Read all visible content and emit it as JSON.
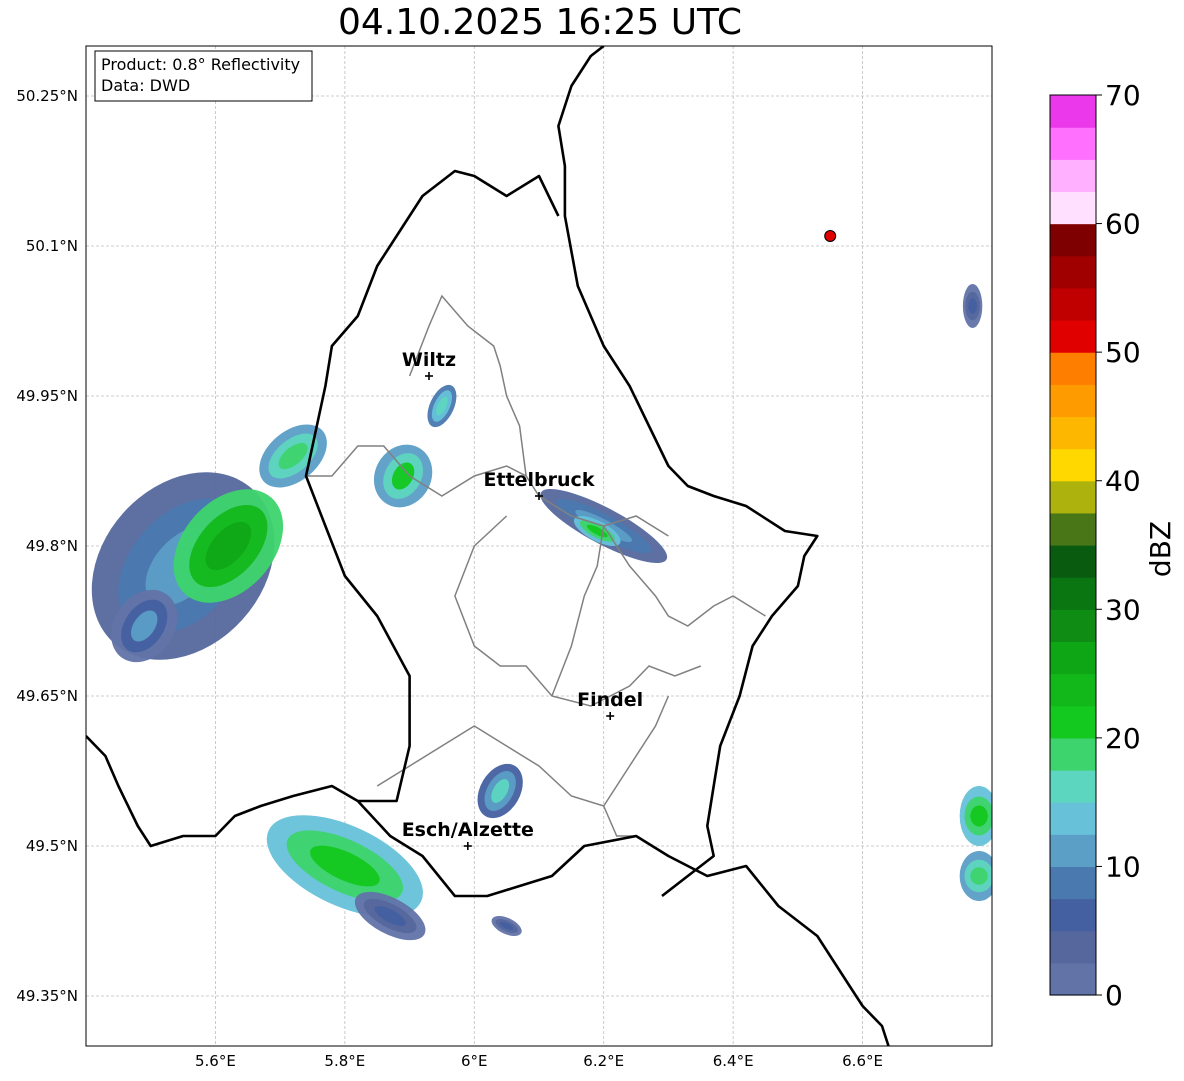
{
  "map": {
    "title": "04.10.2025 16:25 UTC",
    "info": {
      "product": "Product: 0.8° Reflectivity",
      "data": "Data: DWD"
    },
    "lat_ticks": [
      "50.25°N",
      "50.1°N",
      "49.95°N",
      "49.8°N",
      "49.65°N",
      "49.5°N",
      "49.35°N"
    ],
    "lon_ticks": [
      "5.6°E",
      "5.8°E",
      "6°E",
      "6.2°E",
      "6.4°E",
      "6.6°E"
    ],
    "extent": {
      "lon_min": 5.4,
      "lon_max": 6.8,
      "lat_min": 49.3,
      "lat_max": 50.3
    },
    "cities": [
      {
        "name": "Wiltz",
        "lon": 5.93,
        "lat": 49.97
      },
      {
        "name": "Ettelbruck",
        "lon": 6.1,
        "lat": 49.85
      },
      {
        "name": "Findel",
        "lon": 6.21,
        "lat": 49.63
      },
      {
        "name": "Esch/Alzette",
        "lon": 5.99,
        "lat": 49.5
      }
    ],
    "marker": {
      "lon": 6.55,
      "lat": 50.11,
      "color": "#e00000"
    }
  },
  "colorbar": {
    "label": "dBZ",
    "tick_labels": [
      "0",
      "10",
      "20",
      "30",
      "40",
      "50",
      "60",
      "70"
    ],
    "min": 0,
    "max": 70,
    "step": 2.5,
    "colors": [
      "#6273a8",
      "#55679d",
      "#4560a0",
      "#4a79b0",
      "#5b9ec6",
      "#66c1d9",
      "#5dd6c0",
      "#3dd46d",
      "#13c81e",
      "#12b81a",
      "#0fa616",
      "#0e8c14",
      "#0a7612",
      "#095c0f",
      "#497616",
      "#adb30c",
      "#ffd800",
      "#fdb700",
      "#fe9b00",
      "#fe7e00",
      "#e00000",
      "#c00000",
      "#a00000",
      "#7f0000",
      "#ffe0ff",
      "#ffb0ff",
      "#ff70ff",
      "#ea38ea"
    ]
  },
  "radar_echoes": [
    {
      "lon": 5.55,
      "lat": 49.78,
      "rx": 0.16,
      "ry": 0.08,
      "angle": -48,
      "dbz": 12
    },
    {
      "lon": 5.62,
      "lat": 49.8,
      "rx": 0.1,
      "ry": 0.045,
      "angle": -48,
      "dbz": 26
    },
    {
      "lon": 5.72,
      "lat": 49.89,
      "rx": 0.06,
      "ry": 0.025,
      "angle": -40,
      "dbz": 18
    },
    {
      "lon": 5.49,
      "lat": 49.72,
      "rx": 0.06,
      "ry": 0.03,
      "angle": -55,
      "dbz": 10
    },
    {
      "lon": 5.89,
      "lat": 49.87,
      "rx": 0.05,
      "ry": 0.028,
      "angle": -60,
      "dbz": 20
    },
    {
      "lon": 5.95,
      "lat": 49.94,
      "rx": 0.035,
      "ry": 0.012,
      "angle": -65,
      "dbz": 16
    },
    {
      "lon": 6.2,
      "lat": 49.82,
      "rx": 0.11,
      "ry": 0.018,
      "angle": 28,
      "dbz": 12
    },
    {
      "lon": 6.19,
      "lat": 49.815,
      "rx": 0.04,
      "ry": 0.01,
      "angle": 28,
      "dbz": 22
    },
    {
      "lon": 6.04,
      "lat": 49.555,
      "rx": 0.045,
      "ry": 0.02,
      "angle": -60,
      "dbz": 15
    },
    {
      "lon": 5.8,
      "lat": 49.48,
      "rx": 0.13,
      "ry": 0.04,
      "angle": 25,
      "dbz": 22
    },
    {
      "lon": 5.87,
      "lat": 49.43,
      "rx": 0.06,
      "ry": 0.018,
      "angle": 28,
      "dbz": 6
    },
    {
      "lon": 6.05,
      "lat": 49.42,
      "rx": 0.025,
      "ry": 0.008,
      "angle": 25,
      "dbz": 6
    },
    {
      "lon": 6.77,
      "lat": 50.04,
      "rx": 0.015,
      "ry": 0.022,
      "angle": 0,
      "dbz": 6
    },
    {
      "lon": 6.78,
      "lat": 49.53,
      "rx": 0.03,
      "ry": 0.03,
      "angle": 0,
      "dbz": 22
    },
    {
      "lon": 6.78,
      "lat": 49.47,
      "rx": 0.03,
      "ry": 0.025,
      "angle": 0,
      "dbz": 18
    }
  ],
  "borders": {
    "country": [
      [
        [
          5.4,
          49.61
        ],
        [
          5.43,
          49.59
        ],
        [
          5.45,
          49.56
        ],
        [
          5.48,
          49.52
        ],
        [
          5.5,
          49.5
        ],
        [
          5.55,
          49.51
        ],
        [
          5.6,
          49.51
        ],
        [
          5.63,
          49.53
        ],
        [
          5.67,
          49.54
        ],
        [
          5.72,
          49.55
        ],
        [
          5.78,
          49.56
        ],
        [
          5.82,
          49.545
        ],
        [
          5.87,
          49.51
        ],
        [
          5.92,
          49.49
        ],
        [
          5.97,
          49.45
        ],
        [
          6.02,
          49.45
        ],
        [
          6.07,
          49.46
        ],
        [
          6.12,
          49.47
        ],
        [
          6.17,
          49.5
        ],
        [
          6.25,
          49.51
        ],
        [
          6.3,
          49.49
        ],
        [
          6.36,
          49.47
        ],
        [
          6.42,
          49.48
        ],
        [
          6.47,
          49.44
        ],
        [
          6.53,
          49.41
        ],
        [
          6.58,
          49.36
        ],
        [
          6.6,
          49.34
        ],
        [
          6.63,
          49.32
        ],
        [
          6.64,
          49.3
        ]
      ],
      [
        [
          6.29,
          49.45
        ],
        [
          6.33,
          49.47
        ],
        [
          6.37,
          49.49
        ],
        [
          6.36,
          49.52
        ],
        [
          6.37,
          49.56
        ],
        [
          6.38,
          49.6
        ],
        [
          6.41,
          49.65
        ],
        [
          6.43,
          49.7
        ],
        [
          6.46,
          49.73
        ],
        [
          6.5,
          49.76
        ],
        [
          6.51,
          49.79
        ],
        [
          6.53,
          49.81
        ],
        [
          6.48,
          49.815
        ],
        [
          6.42,
          49.84
        ],
        [
          6.37,
          49.85
        ],
        [
          6.33,
          49.86
        ],
        [
          6.3,
          49.88
        ],
        [
          6.27,
          49.92
        ],
        [
          6.24,
          49.96
        ],
        [
          6.2,
          50.0
        ],
        [
          6.16,
          50.06
        ],
        [
          6.14,
          50.13
        ],
        [
          6.14,
          50.18
        ],
        [
          6.13,
          50.22
        ],
        [
          6.15,
          50.26
        ],
        [
          6.18,
          50.29
        ],
        [
          6.2,
          50.3
        ]
      ],
      [
        [
          6.13,
          50.13
        ],
        [
          6.1,
          50.17
        ],
        [
          6.05,
          50.15
        ],
        [
          6.0,
          50.17
        ],
        [
          5.97,
          50.175
        ],
        [
          5.92,
          50.15
        ],
        [
          5.88,
          50.11
        ],
        [
          5.85,
          50.08
        ],
        [
          5.82,
          50.03
        ],
        [
          5.78,
          50.0
        ],
        [
          5.77,
          49.96
        ],
        [
          5.75,
          49.9
        ],
        [
          5.74,
          49.87
        ],
        [
          5.77,
          49.82
        ],
        [
          5.8,
          49.77
        ],
        [
          5.85,
          49.73
        ],
        [
          5.9,
          49.67
        ],
        [
          5.9,
          49.6
        ],
        [
          5.88,
          49.545
        ],
        [
          5.82,
          49.545
        ]
      ]
    ],
    "cantons": [
      [
        [
          5.74,
          49.87
        ],
        [
          5.78,
          49.87
        ],
        [
          5.82,
          49.9
        ],
        [
          5.86,
          49.9
        ],
        [
          5.9,
          49.87
        ],
        [
          5.95,
          49.85
        ],
        [
          6.0,
          49.87
        ],
        [
          6.05,
          49.88
        ],
        [
          6.08,
          49.87
        ],
        [
          6.1,
          49.85
        ],
        [
          6.15,
          49.83
        ],
        [
          6.2,
          49.82
        ],
        [
          6.25,
          49.83
        ],
        [
          6.3,
          49.81
        ]
      ],
      [
        [
          5.9,
          49.97
        ],
        [
          5.93,
          50.02
        ],
        [
          5.95,
          50.05
        ],
        [
          5.99,
          50.02
        ],
        [
          6.03,
          50.0
        ],
        [
          6.04,
          49.98
        ],
        [
          6.05,
          49.95
        ],
        [
          6.07,
          49.92
        ],
        [
          6.08,
          49.87
        ]
      ],
      [
        [
          6.05,
          49.83
        ],
        [
          6.0,
          49.8
        ],
        [
          5.97,
          49.75
        ],
        [
          6.0,
          49.7
        ],
        [
          6.04,
          49.68
        ],
        [
          6.08,
          49.68
        ],
        [
          6.12,
          49.65
        ],
        [
          6.18,
          49.64
        ],
        [
          6.24,
          49.66
        ],
        [
          6.27,
          49.68
        ],
        [
          6.31,
          49.67
        ],
        [
          6.35,
          49.68
        ]
      ],
      [
        [
          6.2,
          49.82
        ],
        [
          6.24,
          49.78
        ],
        [
          6.28,
          49.75
        ],
        [
          6.3,
          49.73
        ],
        [
          6.33,
          49.72
        ],
        [
          6.37,
          49.74
        ],
        [
          6.4,
          49.75
        ],
        [
          6.45,
          49.73
        ]
      ],
      [
        [
          5.85,
          49.56
        ],
        [
          5.9,
          49.58
        ],
        [
          5.95,
          49.6
        ],
        [
          6.0,
          49.62
        ],
        [
          6.05,
          49.6
        ],
        [
          6.1,
          49.58
        ],
        [
          6.15,
          49.55
        ],
        [
          6.2,
          49.54
        ],
        [
          6.24,
          49.58
        ],
        [
          6.28,
          49.62
        ],
        [
          6.3,
          49.65
        ]
      ],
      [
        [
          6.2,
          49.54
        ],
        [
          6.22,
          49.51
        ],
        [
          6.25,
          49.51
        ]
      ],
      [
        [
          6.12,
          49.65
        ],
        [
          6.15,
          49.7
        ],
        [
          6.17,
          49.75
        ],
        [
          6.19,
          49.78
        ],
        [
          6.2,
          49.82
        ]
      ]
    ]
  }
}
